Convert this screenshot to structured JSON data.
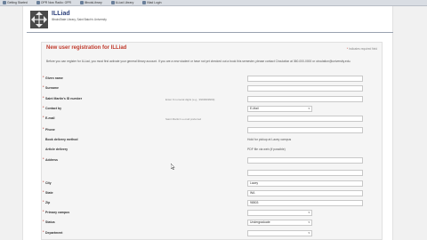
{
  "bookmarks": [
    "Getting Started",
    "OPR Now Radio: OPR",
    "IllinoisLibrary",
    "ILLiad Library",
    "Illiad Login"
  ],
  "brand": {
    "title": "ILLiad",
    "subtitle": "IllinoisState Library, Saint Batch's University"
  },
  "form": {
    "title": "New user registration for ILLiad",
    "required_note": "Indicates required field",
    "intro": "Before you can register for ILLiad, you must first activate your general library account. If you are a new student or have not yet checked out a book this semester, please contact Circulation at 360-000-0000 or circulation@university.edu.",
    "fields": [
      {
        "label": "Given name",
        "required": true,
        "hint": "",
        "type": "text",
        "value": ""
      },
      {
        "label": "Surname",
        "required": true,
        "hint": "",
        "type": "text",
        "value": ""
      },
      {
        "label": "Saint Martin's ID number",
        "required": true,
        "hint": "Enter 9 numeral digits (e.g., 9999999999)",
        "type": "text",
        "value": ""
      },
      {
        "label": "Contact by",
        "required": true,
        "hint": "",
        "type": "select",
        "value": "E-Mail"
      },
      {
        "label": "E-mail",
        "required": true,
        "hint": "Saint Martin's e-mail preferred",
        "type": "text",
        "value": ""
      },
      {
        "label": "Phone",
        "required": true,
        "hint": "",
        "type": "text",
        "value": ""
      },
      {
        "label": "Book delivery method",
        "required": false,
        "hint": "",
        "type": "static",
        "value": "Hold for pickup at Lacey campus"
      },
      {
        "label": "Article delivery",
        "required": false,
        "hint": "",
        "type": "static",
        "value": "PDF file via web (if possible)"
      },
      {
        "label": "Address",
        "required": true,
        "hint": "",
        "type": "text",
        "value": ""
      },
      {
        "label": "",
        "required": false,
        "hint": "",
        "type": "text",
        "value": ""
      },
      {
        "label": "City",
        "required": true,
        "hint": "",
        "type": "text",
        "value": "Lacey"
      },
      {
        "label": "State",
        "required": true,
        "hint": "",
        "type": "text",
        "value": "WA"
      },
      {
        "label": "Zip",
        "required": true,
        "hint": "",
        "type": "text",
        "value": "98503"
      },
      {
        "label": "Primary campus",
        "required": true,
        "hint": "",
        "type": "select",
        "value": ""
      },
      {
        "label": "Status",
        "required": true,
        "hint": "",
        "type": "select",
        "value": "Undergraduate"
      },
      {
        "label": "Department",
        "required": true,
        "hint": "",
        "type": "select",
        "value": ""
      }
    ]
  }
}
